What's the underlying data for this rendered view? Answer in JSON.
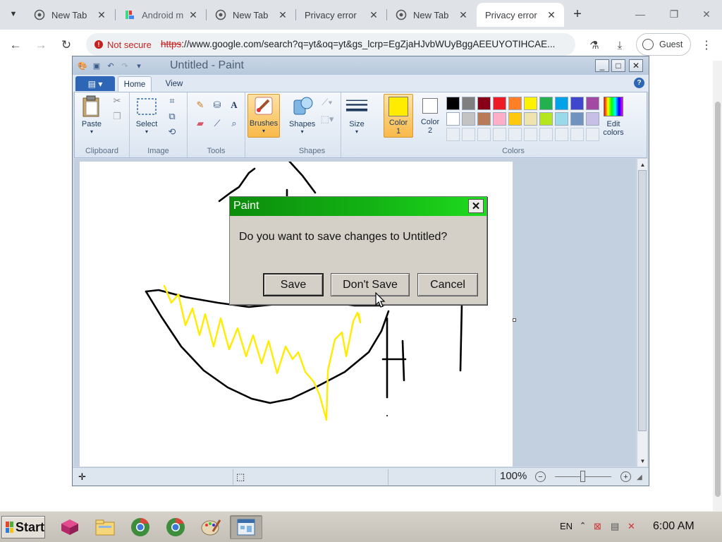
{
  "browser": {
    "tabs": [
      {
        "title": "New Tab",
        "icon": "chrome-icon"
      },
      {
        "title": "Android m",
        "icon": "android-studio-icon"
      },
      {
        "title": "New Tab",
        "icon": "chrome-icon"
      },
      {
        "title": "Privacy error",
        "icon": "none"
      },
      {
        "title": "New Tab",
        "icon": "chrome-icon"
      },
      {
        "title": "Privacy error",
        "icon": "none",
        "active": true
      }
    ],
    "security_label": "Not secure",
    "url_protocol": "https",
    "url_rest": "://www.google.com/search?q=yt&oq=yt&gs_lcrp=EgZjaHJvbWUyBggAEEUYOTIHCAE...",
    "profile_label": "Guest"
  },
  "paint": {
    "title": "Untitled - Paint",
    "ribbon_tabs": [
      "Home",
      "View"
    ],
    "groups": {
      "clipboard": "Clipboard",
      "image": "Image",
      "tools": "Tools",
      "shapes": "Shapes",
      "colors": "Colors"
    },
    "buttons": {
      "paste": "Paste",
      "select": "Select",
      "brushes": "Brushes",
      "shapes": "Shapes",
      "size": "Size",
      "color1": "Color",
      "color1_num": "1",
      "color2": "Color",
      "color2_num": "2",
      "edit_colors_1": "Edit",
      "edit_colors_2": "colors"
    },
    "color1": "#ffec00",
    "color2": "#ffffff",
    "palette_row1": [
      "#000000",
      "#7f7f7f",
      "#880015",
      "#ed1c24",
      "#ff7f27",
      "#fff200",
      "#22b14c",
      "#00a2e8",
      "#3f48cc",
      "#a349a4"
    ],
    "palette_row2": [
      "#ffffff",
      "#c3c3c3",
      "#b97a57",
      "#ffaec9",
      "#ffc90e",
      "#efe4b0",
      "#b5e61d",
      "#99d9ea",
      "#7092be",
      "#c8bfe7"
    ],
    "zoom": "100%"
  },
  "dialog": {
    "title": "Paint",
    "message": "Do you want to save changes to Untitled?",
    "save": "Save",
    "dont_save": "Don't Save",
    "cancel": "Cancel"
  },
  "taskbar": {
    "start": "Start",
    "language": "EN",
    "clock": "6:00 AM"
  }
}
